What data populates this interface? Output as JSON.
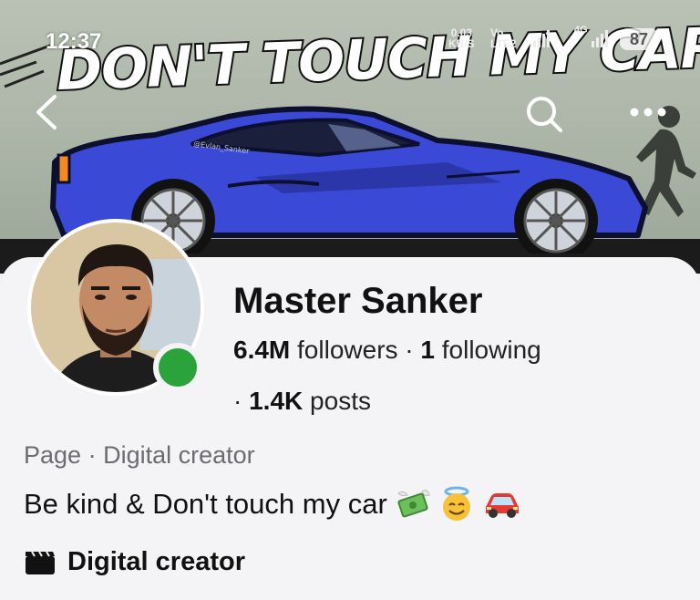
{
  "status_bar": {
    "time": "12:37",
    "speed_value": "0.03",
    "speed_unit": "KB/S",
    "vo_label": "Vo",
    "lte_label": "LTE2",
    "network_label": "4G",
    "battery": "87"
  },
  "cover": {
    "title": "DON'T TOUCH MY CAR!",
    "car_plate": "@Evlan_Sanker"
  },
  "nav": {
    "back_icon": "chevron-left-icon",
    "search_icon": "search-icon",
    "more_icon": "more-horizontal-icon"
  },
  "profile": {
    "name": "Master Sanker",
    "followers_count": "6.4M",
    "followers_label": "followers",
    "separator": "·",
    "following_count": "1",
    "following_label": "following",
    "posts_count": "1.4K",
    "posts_label": "posts",
    "page_type": "Page",
    "category": "Digital creator",
    "bio": "Be kind & Don't touch my car",
    "bio_icons": [
      "money-with-wings-icon",
      "halo-smile-icon",
      "red-car-icon"
    ],
    "creator_label": "Digital creator",
    "creator_icon": "clapperboard-icon",
    "online_color": "#2aa43a"
  }
}
